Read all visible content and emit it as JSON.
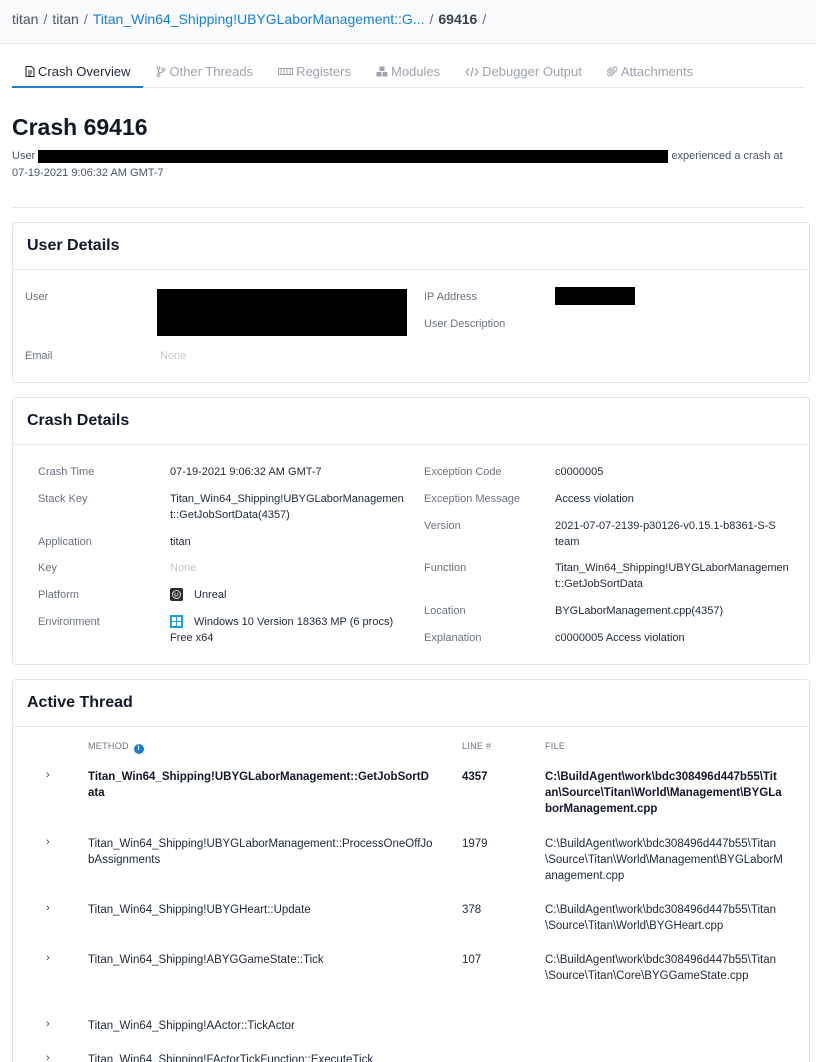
{
  "breadcrumb": {
    "items": [
      "titan",
      "titan",
      "Titan_Win64_Shipping!UBYGLaborManagement::G...",
      "69416"
    ],
    "separator": "/"
  },
  "tabs": [
    {
      "label": "Crash Overview",
      "icon": "document-icon",
      "active": true
    },
    {
      "label": "Other Threads",
      "icon": "branch-icon",
      "active": false
    },
    {
      "label": "Registers",
      "icon": "memory-icon",
      "active": false
    },
    {
      "label": "Modules",
      "icon": "cubes-icon",
      "active": false
    },
    {
      "label": "Debugger Output",
      "icon": "code-icon",
      "active": false
    },
    {
      "label": "Attachments",
      "icon": "paperclip-icon",
      "active": false
    }
  ],
  "crash": {
    "title": "Crash 69416",
    "subtitle_prefix": "User",
    "subtitle_suffix": "experienced a crash at",
    "subtitle_time": "07-19-2021 9:06:32 AM GMT-7"
  },
  "user_details": {
    "heading": "User Details",
    "user_label": "User",
    "email_label": "Email",
    "email_value": "None",
    "ip_label": "IP Address",
    "description_label": "User Description"
  },
  "crash_details": {
    "heading": "Crash Details",
    "left": [
      {
        "label": "Crash Time",
        "value": "07-19-2021 9:06:32 AM GMT-7"
      },
      {
        "label": "Stack Key",
        "value": "Titan_Win64_Shipping!UBYGLaborManagemen t::GetJobSortData(4357)"
      },
      {
        "label": "Application",
        "value": "titan"
      },
      {
        "label": "Key",
        "value": "None"
      },
      {
        "label": "Platform",
        "value": "Unreal",
        "icon": "unreal-icon"
      },
      {
        "label": "Environment",
        "value": "Windows 10 Version 18363 MP (6 procs) Free x64",
        "icon": "windows-icon"
      }
    ],
    "right": [
      {
        "label": "Exception Code",
        "value": "c0000005"
      },
      {
        "label": "Exception Message",
        "value": "Access violation"
      },
      {
        "label": "Version",
        "value": "2021-07-07-2139-p30126-v0.15.1-b8361-S-Steam"
      },
      {
        "label": "Function",
        "value": "Titan_Win64_Shipping!UBYGLaborManagemen t::GetJobSortData"
      },
      {
        "label": "Location",
        "value": "BYGLaborManagement.cpp(4357)"
      },
      {
        "label": "Explanation",
        "value": "c0000005 Access violation"
      }
    ]
  },
  "active_thread": {
    "heading": "Active Thread",
    "columns": {
      "method": "METHOD",
      "line": "LINE #",
      "file": "FILE"
    },
    "rows": [
      {
        "method": "Titan_Win64_Shipping!UBYGLaborManagement::GetJobSortData",
        "line": "4357",
        "file": "C:\\BuildAgent\\work\\bdc308496d447b55\\Titan\\Source\\Titan\\World\\Management\\BYGLaborManagement.cpp"
      },
      {
        "method": "Titan_Win64_Shipping!UBYGLaborManagement::ProcessOneOffJobAssignments",
        "line": "1979",
        "file": "C:\\BuildAgent\\work\\bdc308496d447b55\\Titan\\Source\\Titan\\World\\Management\\BYGLaborManagement.cpp"
      },
      {
        "method": "Titan_Win64_Shipping!UBYGHeart::Update",
        "line": "378",
        "file": "C:\\BuildAgent\\work\\bdc308496d447b55\\Titan\\Source\\Titan\\World\\BYGHeart.cpp"
      },
      {
        "method": "Titan_Win64_Shipping!ABYGGameState::Tick",
        "line": "107",
        "file": "C:\\BuildAgent\\work\\bdc308496d447b55\\Titan\\Source\\Titan\\Core\\BYGGameState.cpp"
      },
      {
        "method": "Titan_Win64_Shipping!AActor::TickActor",
        "line": "",
        "file": ""
      },
      {
        "method": "Titan_Win64_Shipping!FActorTickFunction::ExecuteTick",
        "line": "",
        "file": ""
      }
    ]
  },
  "colors": {
    "accent": "#1a7fd1",
    "redaction": "#000000"
  }
}
